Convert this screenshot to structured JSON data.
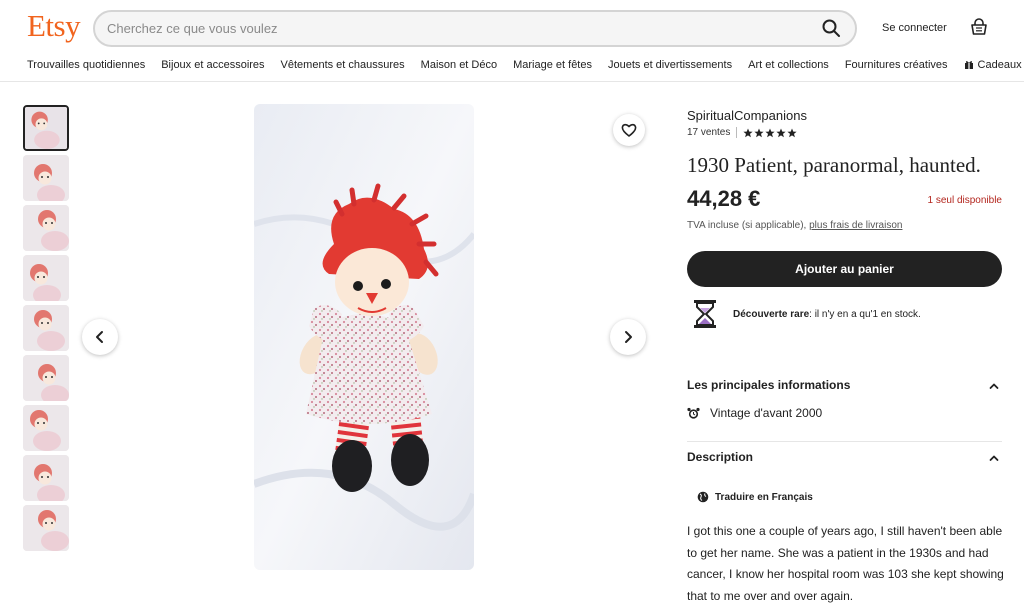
{
  "header": {
    "logo": "Etsy",
    "search_placeholder": "Cherchez ce que vous voulez",
    "sign_in": "Se connecter"
  },
  "nav": {
    "items": [
      "Trouvailles quotidiennes",
      "Bijoux et accessoires",
      "Vêtements et chaussures",
      "Maison et Déco",
      "Mariage et fêtes",
      "Jouets et divertissements",
      "Art et collections",
      "Fournitures créatives"
    ],
    "gifts": "Cadeaux"
  },
  "listing": {
    "shop_name": "SpiritualCompanions",
    "sales": "17 ventes",
    "rating_stars": 5,
    "title": "1930 Patient, paranormal, haunted.",
    "price": "44,28 €",
    "stock_note": "1 seul disponible",
    "vat_text": "TVA incluse (si applicable), ",
    "vat_link": "plus frais de livraison",
    "add_to_cart": "Ajouter au panier",
    "rare_label": "Découverte rare",
    "rare_text": ": il n'y en a qu'1 en stock.",
    "image_count": 9,
    "active_image": 1
  },
  "details": {
    "heading": "Les principales informations",
    "items": [
      "Vintage d'avant 2000"
    ]
  },
  "description": {
    "heading": "Description",
    "translate": "Traduire en Français",
    "text": "I got this one a couple of years ago, I still haven't been able to get her name. She was a patient in the 1930s and had cancer, I know her hospital room was 103 she kept showing that to me over and over again."
  },
  "colors": {
    "brand": "#f1641e",
    "button": "#222222",
    "stock_red": "#b3261e"
  }
}
